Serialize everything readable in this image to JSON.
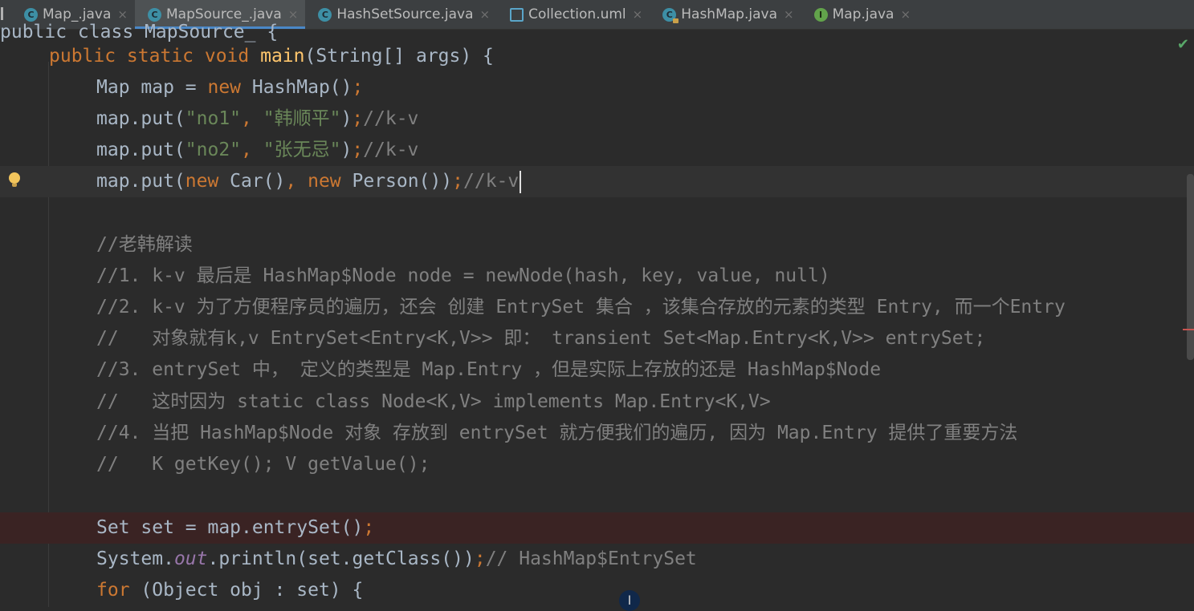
{
  "tabs": [
    {
      "label": "Map_.java",
      "icon": "class-icon",
      "active": false
    },
    {
      "label": "MapSource_.java",
      "icon": "class-icon",
      "active": true
    },
    {
      "label": "HashSetSource.java",
      "icon": "class-icon",
      "active": false
    },
    {
      "label": "Collection.uml",
      "icon": "uml-icon",
      "active": false
    },
    {
      "label": "HashMap.java",
      "icon": "class-locked-icon",
      "active": false
    },
    {
      "label": "Map.java",
      "icon": "interface-icon",
      "active": false
    }
  ],
  "tab_close_glyph": "×",
  "icon_letters": {
    "class": "C",
    "interface": "I"
  },
  "status": {
    "check_glyph": "✔"
  },
  "cursor_glyph": "I",
  "code_lines": [
    [
      [
        "pl",
        "public class MapSource_ {"
      ]
    ],
    [
      [
        "kw",
        "public static void "
      ],
      [
        "fn",
        "main"
      ],
      [
        "pl",
        "(String[] args) {"
      ]
    ],
    [
      [
        "pl",
        "Map map = "
      ],
      [
        "kw",
        "new "
      ],
      [
        "pl",
        "HashMap()"
      ],
      [
        "kw",
        ";"
      ]
    ],
    [
      [
        "pl",
        "map.put("
      ],
      [
        "str",
        "\"no1\""
      ],
      [
        "kw",
        ", "
      ],
      [
        "str",
        "\"韩顺平\""
      ],
      [
        "pl",
        ")"
      ],
      [
        "kw",
        ";"
      ],
      [
        "com",
        "//k-v"
      ]
    ],
    [
      [
        "pl",
        "map.put("
      ],
      [
        "str",
        "\"no2\""
      ],
      [
        "kw",
        ", "
      ],
      [
        "str",
        "\"张无忌\""
      ],
      [
        "pl",
        ")"
      ],
      [
        "kw",
        ";"
      ],
      [
        "com",
        "//k-v"
      ]
    ],
    [
      [
        "pl",
        "map.put("
      ],
      [
        "kw",
        "new "
      ],
      [
        "pl",
        "Car()"
      ],
      [
        "kw",
        ", new "
      ],
      [
        "pl",
        "Person())"
      ],
      [
        "kw",
        ";"
      ],
      [
        "com",
        "//k-v"
      ]
    ],
    [],
    [
      [
        "com",
        "//老韩解读"
      ]
    ],
    [
      [
        "com",
        "//1. k-v 最后是 HashMap$Node node = newNode(hash, key, value, null)"
      ]
    ],
    [
      [
        "com",
        "//2. k-v 为了方便程序员的遍历，还会 创建 EntrySet 集合 ，该集合存放的元素的类型 Entry, 而一个Entry"
      ]
    ],
    [
      [
        "com",
        "//   对象就有k,v EntrySet<Entry<K,V>> 即： transient Set<Map.Entry<K,V>> entrySet;"
      ]
    ],
    [
      [
        "com",
        "//3. entrySet 中， 定义的类型是 Map.Entry ，但是实际上存放的还是 HashMap$Node"
      ]
    ],
    [
      [
        "com",
        "//   这时因为 static class Node<K,V> implements Map.Entry<K,V>"
      ]
    ],
    [
      [
        "com",
        "//4. 当把 HashMap$Node 对象 存放到 entrySet 就方便我们的遍历, 因为 Map.Entry 提供了重要方法"
      ]
    ],
    [
      [
        "com",
        "//   K getKey(); V getValue();"
      ]
    ],
    [],
    [
      [
        "pl",
        "Set set = map.entrySet()"
      ],
      [
        "kw",
        ";"
      ]
    ],
    [
      [
        "pl",
        "System."
      ],
      [
        "st",
        "out"
      ],
      [
        "pl",
        ".println(set.getClass())"
      ],
      [
        "kw",
        ";"
      ],
      [
        "com",
        "// HashMap$EntrySet"
      ]
    ],
    [
      [
        "kw",
        "for "
      ],
      [
        "pl",
        "(Object obj : set) {"
      ]
    ]
  ]
}
